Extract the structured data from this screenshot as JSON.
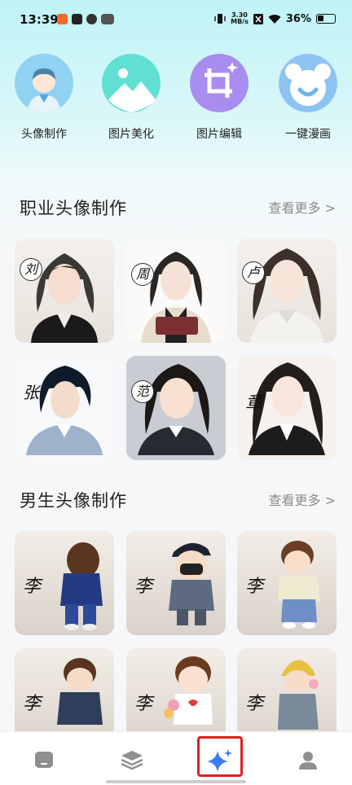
{
  "status": {
    "time": "13:39",
    "net_speed_value": "3.30",
    "net_speed_unit": "MB/s",
    "battery": "36%"
  },
  "tools": [
    {
      "label": "头像制作",
      "icon": "avatar-icon"
    },
    {
      "label": "图片美化",
      "icon": "landscape-icon"
    },
    {
      "label": "图片编辑",
      "icon": "crop-icon"
    },
    {
      "label": "一键漫画",
      "icon": "bear-icon"
    }
  ],
  "sections": {
    "professional": {
      "title": "职业头像制作",
      "more": "查看更多 >"
    },
    "male": {
      "title": "男生头像制作",
      "more": "查看更多 >"
    }
  },
  "professional_cards": [
    {
      "surname": "刘"
    },
    {
      "surname": "周"
    },
    {
      "surname": "卢"
    },
    {
      "surname": "张"
    },
    {
      "surname": "范"
    },
    {
      "surname": "章"
    }
  ],
  "male_cards": [
    {
      "surname": "李"
    },
    {
      "surname": "李"
    },
    {
      "surname": "李"
    },
    {
      "surname": "李"
    },
    {
      "surname": "李"
    },
    {
      "surname": "李"
    }
  ],
  "nav": [
    {
      "icon": "home-icon"
    },
    {
      "icon": "layers-icon"
    },
    {
      "icon": "sparkle-icon",
      "active": true
    },
    {
      "icon": "profile-icon"
    }
  ],
  "colors": {
    "accent_blue": "#3d7cf0",
    "highlight_red": "#e02020",
    "more_gray": "#8c8c8c"
  }
}
